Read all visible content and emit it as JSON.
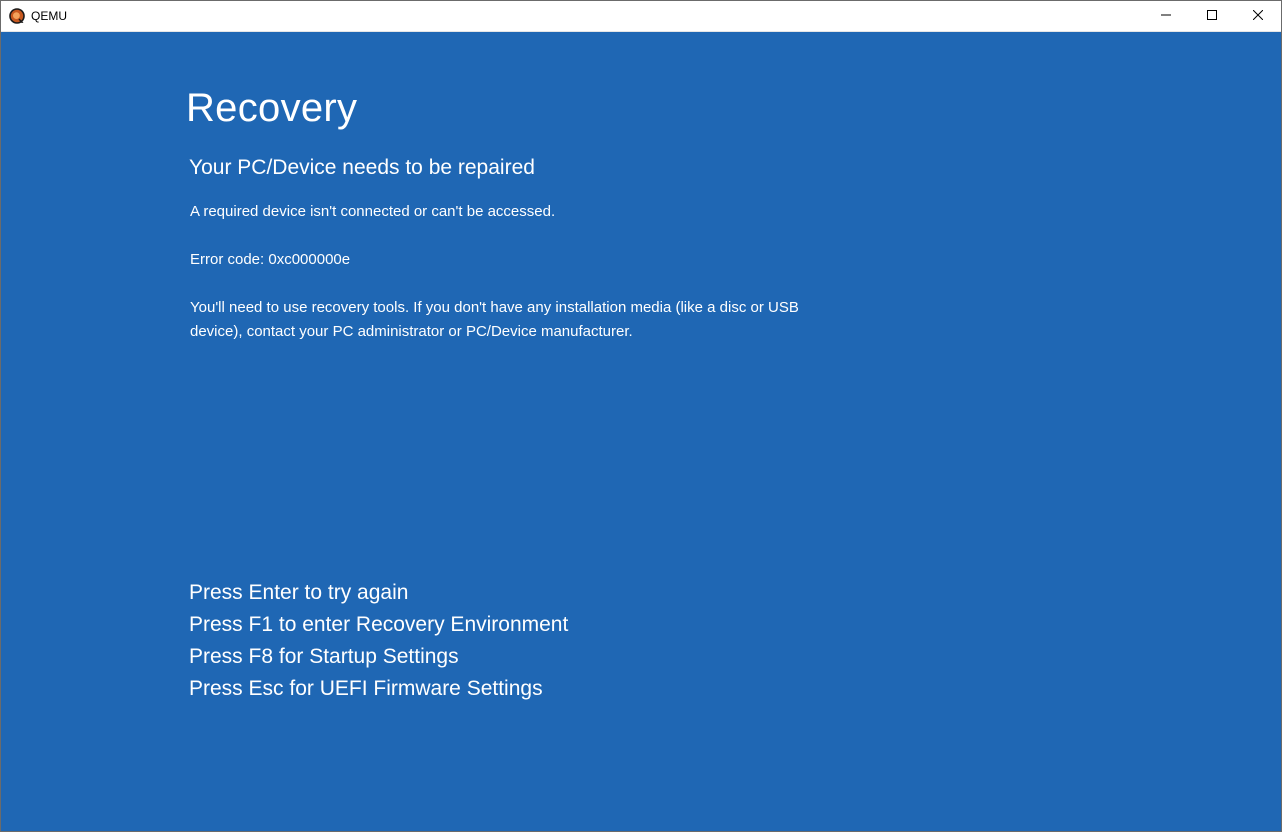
{
  "window": {
    "title": "QEMU",
    "app_icon": "qemu-logo-icon",
    "controls": {
      "minimize_icon": "minimize-icon",
      "maximize_icon": "maximize-icon",
      "close_icon": "close-icon"
    }
  },
  "screen": {
    "background_color": "#1f67b4",
    "heading": "Recovery",
    "subheading": "Your PC/Device needs to be repaired",
    "message": "A required device isn't connected or can't be accessed.",
    "error_code": "Error code: 0xc000000e",
    "instructions": "You'll need to use recovery tools. If you don't have any installation media (like a disc or USB device), contact your PC administrator or PC/Device manufacturer.",
    "options": [
      "Press Enter to try again",
      "Press F1 to enter Recovery Environment",
      "Press F8 for Startup Settings",
      "Press Esc for UEFI Firmware Settings"
    ]
  }
}
